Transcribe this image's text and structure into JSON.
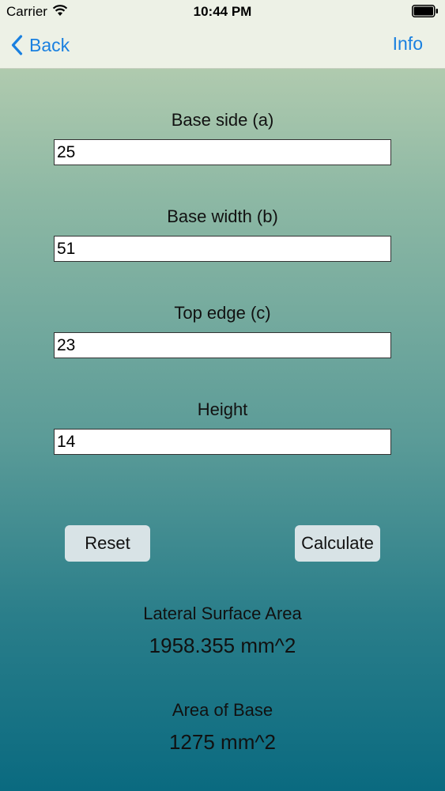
{
  "status_bar": {
    "carrier": "Carrier",
    "time": "10:44 PM"
  },
  "nav": {
    "back_label": "Back",
    "info_label": "Info"
  },
  "fields": [
    {
      "label": "Base side (a)",
      "value": "25"
    },
    {
      "label": "Base width (b)",
      "value": "51"
    },
    {
      "label": "Top edge (c)",
      "value": "23"
    },
    {
      "label": "Height",
      "value": "14"
    }
  ],
  "buttons": {
    "reset": "Reset",
    "calculate": "Calculate"
  },
  "results": [
    {
      "label": "Lateral Surface Area",
      "value": "1958.355 mm^2"
    },
    {
      "label": "Area of Base",
      "value": "1275 mm^2"
    }
  ],
  "colors": {
    "accent": "#1a80e0",
    "bar_bg": "#edf1e6",
    "button_bg": "#d8e3e6"
  }
}
